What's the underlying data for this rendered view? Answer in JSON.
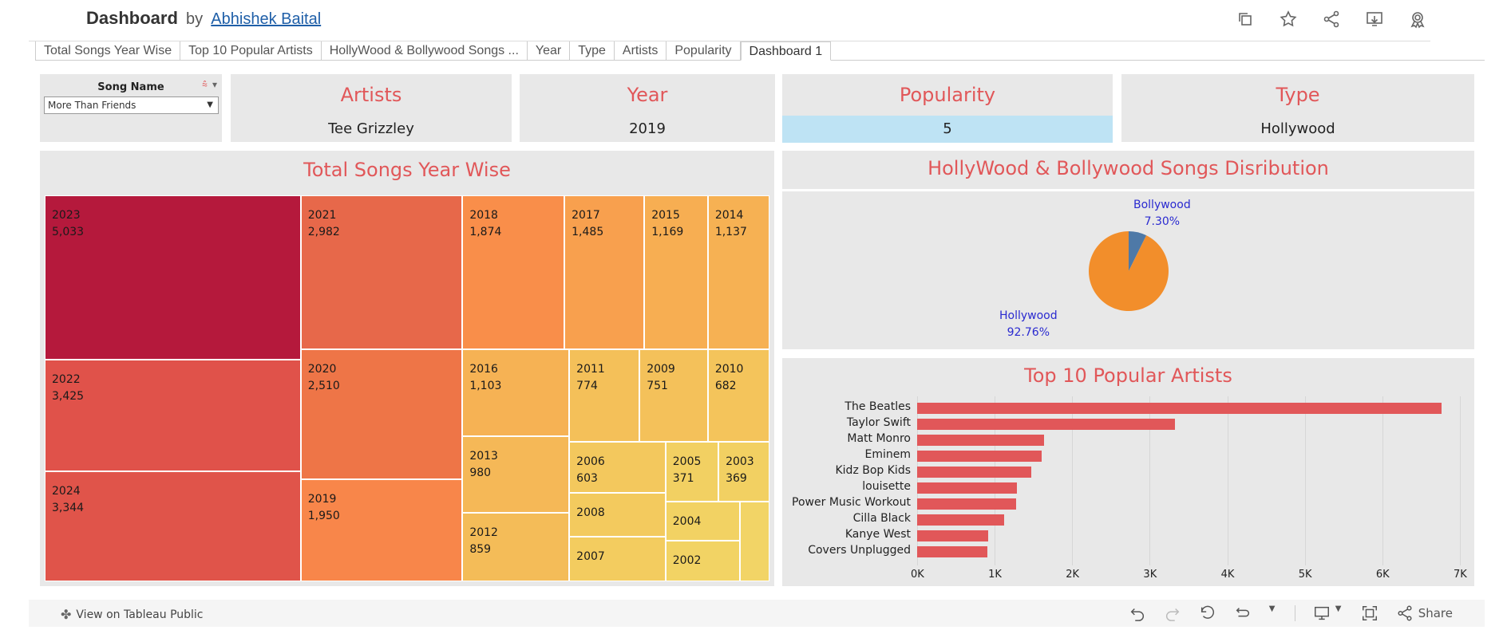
{
  "header": {
    "title": "Dashboard",
    "by": "by",
    "author": "Abhishek Baital",
    "icons": [
      "copy-icon",
      "star-icon",
      "share-icon",
      "download-icon",
      "badge-icon"
    ]
  },
  "tabs": [
    {
      "label": "Total Songs Year Wise"
    },
    {
      "label": "Top 10 Popular Artists"
    },
    {
      "label": "HollyWood & Bollywood Songs ..."
    },
    {
      "label": "Year"
    },
    {
      "label": "Type"
    },
    {
      "label": "Artists"
    },
    {
      "label": "Popularity"
    },
    {
      "label": "Dashboard 1",
      "active": true
    }
  ],
  "filter": {
    "label": "Song Name",
    "value": "More Than Friends"
  },
  "kpis": {
    "artists": {
      "title": "Artists",
      "value": "Tee Grizzley"
    },
    "year": {
      "title": "Year",
      "value": "2019"
    },
    "popularity": {
      "title": "Popularity",
      "value": "5"
    },
    "type": {
      "title": "Type",
      "value": "Hollywood"
    }
  },
  "treemap": {
    "title": "Total Songs Year Wise",
    "cells": [
      {
        "year": "2023",
        "count": "5,033",
        "color": "#b5193c"
      },
      {
        "year": "2022",
        "count": "3,425",
        "color": "#e0524a"
      },
      {
        "year": "2024",
        "count": "3,344",
        "color": "#e0544a"
      },
      {
        "year": "2021",
        "count": "2,982",
        "color": "#e7684a"
      },
      {
        "year": "2020",
        "count": "2,510",
        "color": "#ee7547"
      },
      {
        "year": "2019",
        "count": "1,950",
        "color": "#f8864a"
      },
      {
        "year": "2018",
        "count": "1,874",
        "color": "#f98e4a"
      },
      {
        "year": "2017",
        "count": "1,485",
        "color": "#f8a04e"
      },
      {
        "year": "2015",
        "count": "1,169",
        "color": "#f7ae52"
      },
      {
        "year": "2014",
        "count": "1,137",
        "color": "#f6b153"
      },
      {
        "year": "2016",
        "count": "1,103",
        "color": "#f6b254"
      },
      {
        "year": "2011",
        "count": "774",
        "color": "#f4c059"
      },
      {
        "year": "2009",
        "count": "751",
        "color": "#f4c15a"
      },
      {
        "year": "2010",
        "count": "682",
        "color": "#f4c45b"
      },
      {
        "year": "2013",
        "count": "980",
        "color": "#f5b857"
      },
      {
        "year": "2012",
        "count": "859",
        "color": "#f4bc58"
      },
      {
        "year": "2006",
        "count": "603",
        "color": "#f3c85d"
      },
      {
        "year": "2005",
        "count": "371",
        "color": "#f2d062"
      },
      {
        "year": "2003",
        "count": "369",
        "color": "#f2d062"
      },
      {
        "year": "2008",
        "count": "",
        "color": "#f3ca5e"
      },
      {
        "year": "2004",
        "count": "",
        "color": "#f2d263"
      },
      {
        "year": "2007",
        "count": "",
        "color": "#f3cc5f"
      },
      {
        "year": "2002",
        "count": "",
        "color": "#f2d364"
      },
      {
        "year": "",
        "count": "",
        "color": "#f2d466"
      }
    ]
  },
  "pie": {
    "title": "HollyWood  & Bollywood Songs Disribution",
    "slices": [
      {
        "name": "Bollywood",
        "pct": "7.30%",
        "value": 7.3,
        "color": "#4e79a7"
      },
      {
        "name": "Hollywood",
        "pct": "92.76%",
        "value": 92.7,
        "color": "#f28e2b"
      }
    ]
  },
  "chart_data": {
    "type": "bar",
    "title": "Top 10 Popular Artists",
    "categories": [
      "The Beatles",
      "Taylor Swift",
      "Matt Monro",
      "Eminem",
      "Kidz Bop Kids",
      "louisette",
      "Power Music Workout",
      "Cilla Black",
      "Kanye West",
      "Covers Unplugged"
    ],
    "values": [
      6760,
      3330,
      1640,
      1610,
      1470,
      1290,
      1280,
      1120,
      920,
      910
    ],
    "xlim": [
      0,
      7000
    ],
    "ticks": [
      "0K",
      "1K",
      "2K",
      "3K",
      "4K",
      "5K",
      "6K",
      "7K"
    ],
    "color": "#e15759",
    "grid": true
  },
  "footer": {
    "view_label": "View on Tableau Public",
    "share_label": "Share"
  }
}
